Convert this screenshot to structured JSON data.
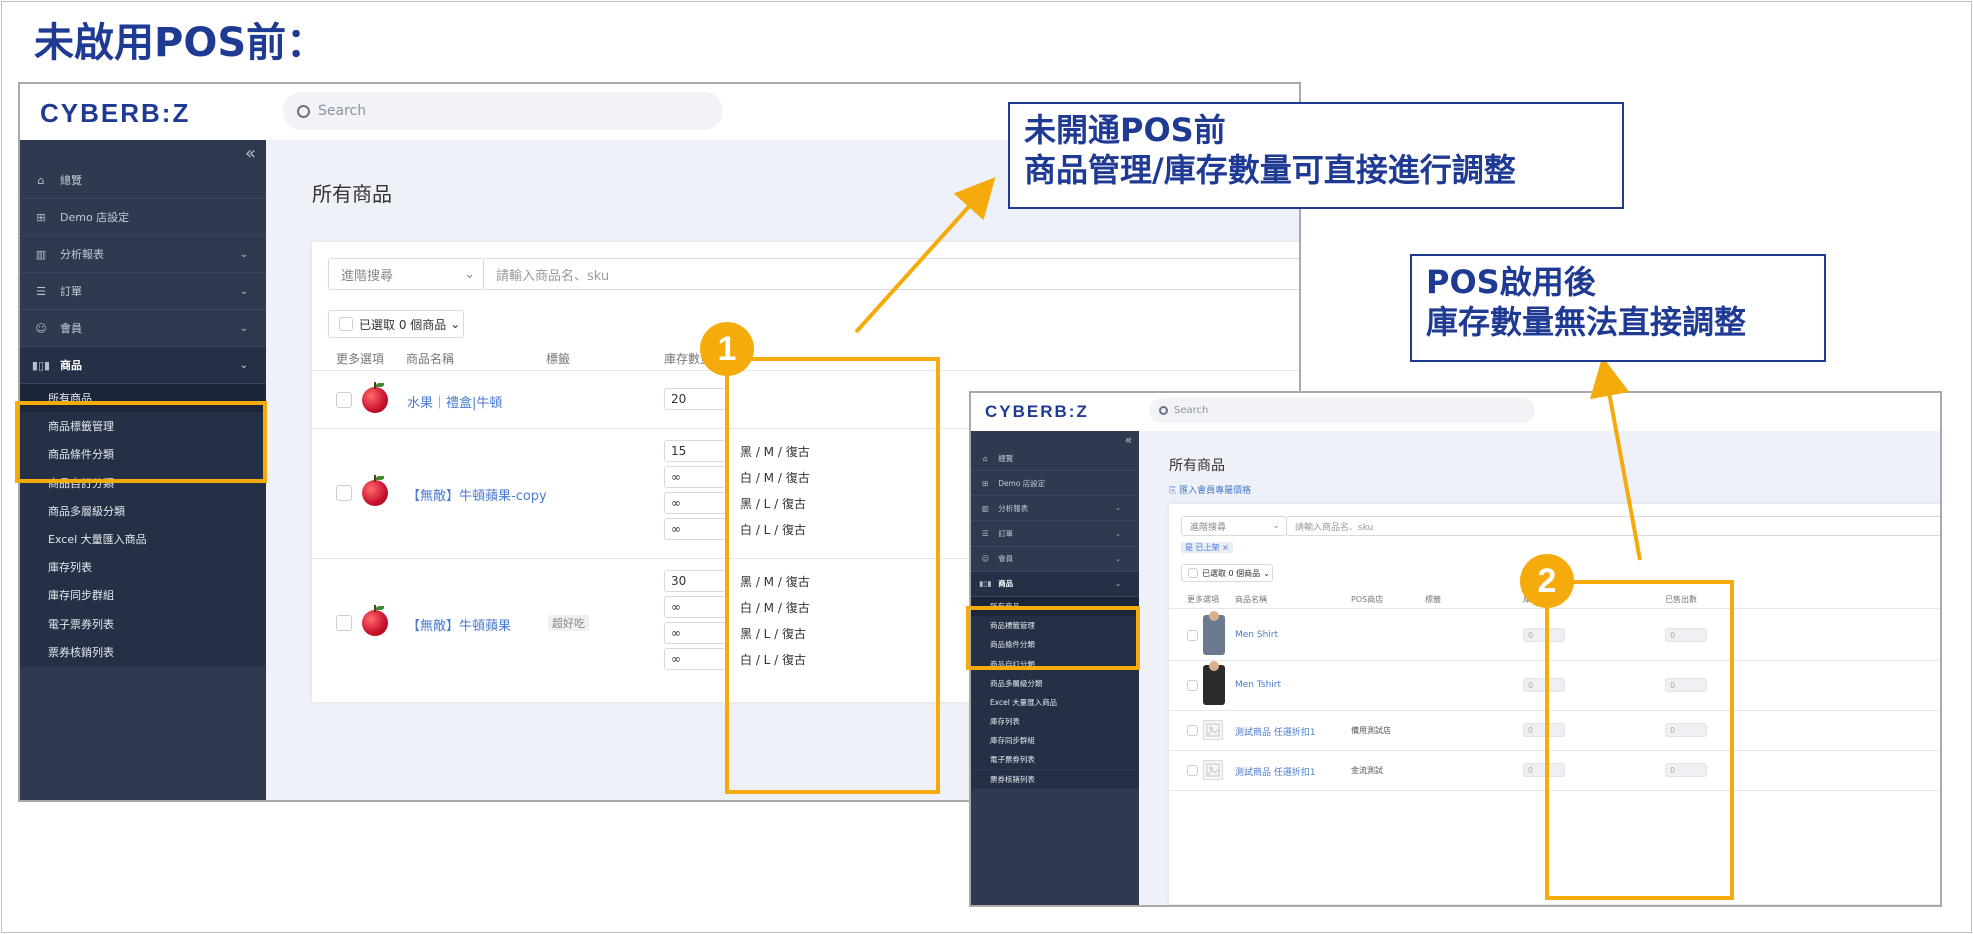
{
  "headings": {
    "before": "未啟用POS前：",
    "after": "POS啟用後："
  },
  "callouts": {
    "before_line1": "未開通POS前",
    "before_line2": "商品管理/庫存數量可直接進行調整",
    "after_line1": "POS啟用後",
    "after_line2": "庫存數量無法直接調整"
  },
  "badges": {
    "one": "1",
    "two": "2"
  },
  "app": {
    "logo": "CYBERB:Z",
    "search_placeholder": "Search",
    "collapse_glyph": "«"
  },
  "sidebar": {
    "items": [
      {
        "label": "總覽",
        "icon": "home-icon",
        "has_chevron": false
      },
      {
        "label": "Demo 店設定",
        "icon": "sitemap-icon",
        "has_chevron": false
      },
      {
        "label": "分析報表",
        "icon": "bar-chart-icon",
        "has_chevron": true
      },
      {
        "label": "訂單",
        "icon": "list-icon",
        "has_chevron": true
      },
      {
        "label": "會員",
        "icon": "users-icon",
        "has_chevron": true
      },
      {
        "label": "商品",
        "icon": "barcode-icon",
        "has_chevron": true
      }
    ],
    "sub_items": [
      "所有商品",
      "商品標籤管理",
      "商品條件分類",
      "商品自訂分類",
      "商品多層級分類",
      "Excel 大量匯入商品",
      "庫存列表",
      "庫存同步群組",
      "電子票券列表",
      "票券核銷列表"
    ]
  },
  "before_page": {
    "title": "所有商品",
    "filter_select": "進階搜尋",
    "filter_input_placeholder": "請輸入商品名、sku",
    "selected_dropdown": "已選取 0 個商品",
    "columns": {
      "more": "更多選項",
      "name": "商品名稱",
      "tag": "標籤",
      "stock": "庫存數量"
    },
    "rows": [
      {
        "name": "水果｜禮盒|牛頓",
        "tag": "",
        "variants": [
          {
            "stock": "20",
            "spec": ""
          }
        ]
      },
      {
        "name": "【無敵】牛頓蘋果-copy",
        "tag": "",
        "variants": [
          {
            "stock": "15",
            "spec": "黑 / M / 復古"
          },
          {
            "stock": "∞",
            "spec": "白 / M / 復古"
          },
          {
            "stock": "∞",
            "spec": "黑 / L / 復古"
          },
          {
            "stock": "∞",
            "spec": "白 / L / 復古"
          }
        ]
      },
      {
        "name": "【無敵】牛頓蘋果",
        "tag": "超好吃",
        "variants": [
          {
            "stock": "30",
            "spec": "黑 / M / 復古"
          },
          {
            "stock": "∞",
            "spec": "白 / M / 復古"
          },
          {
            "stock": "∞",
            "spec": "黑 / L / 復古"
          },
          {
            "stock": "∞",
            "spec": "白 / L / 復古"
          }
        ]
      }
    ]
  },
  "after_page": {
    "title": "所有商品",
    "import_link": "匯入會員專屬價格",
    "filter_select": "進階搜尋",
    "filter_input_placeholder": "請輸入商品名、sku",
    "chip": "是 已上架 ×",
    "selected_dropdown": "已選取 0 個商品",
    "columns": {
      "more": "更多選項",
      "name": "商品名稱",
      "pos": "POS商店",
      "tag": "標籤",
      "stock": "庫存數量",
      "sold": "已售出數"
    },
    "rows": [
      {
        "name": "Men Shirt",
        "pos": "",
        "stock": "0",
        "sold": "0",
        "thumb": "shirt"
      },
      {
        "name": "Men Tshirt",
        "pos": "",
        "stock": "0",
        "sold": "0",
        "thumb": "tshirt"
      },
      {
        "name": "測試商品 任選折扣1",
        "pos": "備用測試店",
        "stock": "0",
        "sold": "0",
        "thumb": "placeholder"
      },
      {
        "name": "測試商品 任選折扣1",
        "pos": "金流測試",
        "stock": "0",
        "sold": "0",
        "thumb": "placeholder"
      }
    ]
  },
  "colors": {
    "accent": "#f5ab0b",
    "brand": "#1f3a93",
    "sidebar": "#2e3a4f"
  }
}
